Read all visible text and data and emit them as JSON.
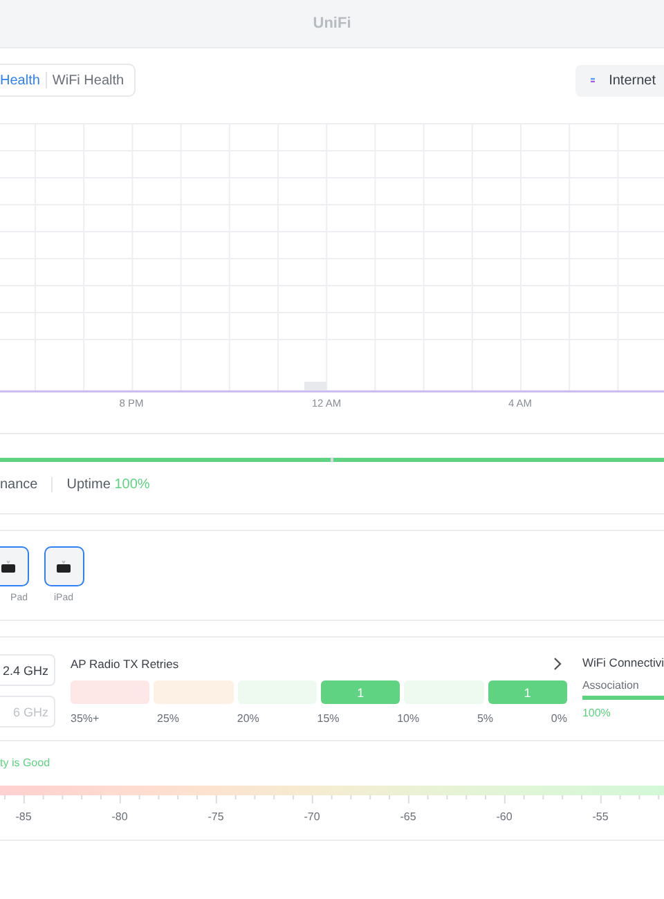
{
  "window": {
    "title": "UniFi"
  },
  "tabs": [
    {
      "label": "Health",
      "selected": true
    },
    {
      "label": "WiFi Health",
      "selected": false
    }
  ],
  "internet_button": {
    "label": "Internet"
  },
  "chart": {
    "time_labels": [
      "8 PM",
      "12 AM",
      "4 AM"
    ]
  },
  "summary": {
    "performance_label": "nance",
    "uptime_label": "Uptime",
    "uptime_value": "100%"
  },
  "devices": [
    {
      "name": "Pad",
      "selected": true
    },
    {
      "name": "iPad",
      "selected": true
    }
  ],
  "bands": [
    {
      "label": "2.4 GHz",
      "disabled": false
    },
    {
      "label": "6 GHz",
      "disabled": true
    }
  ],
  "retries": {
    "title": "AP Radio TX Retries",
    "segments": [
      {
        "color": "#fde7e7"
      },
      {
        "color": "#fdf1e6"
      },
      {
        "color": "#eef9f0"
      },
      {
        "color": "#5fd382",
        "count": "1"
      },
      {
        "color": "#eef9f0"
      },
      {
        "color": "#5fd382",
        "count": "1"
      }
    ],
    "scale_labels": [
      "35%+",
      "25%",
      "20%",
      "15%",
      "10%",
      "5%",
      "0%"
    ]
  },
  "connectivity": {
    "title": "WiFi Connectivi",
    "metric": "Association",
    "level": 1,
    "value": "100%"
  },
  "signal": {
    "status": "ty is Good",
    "scale_labels": [
      "-85",
      "-80",
      "-75",
      "-70",
      "-65",
      "-60",
      "-55"
    ]
  }
}
